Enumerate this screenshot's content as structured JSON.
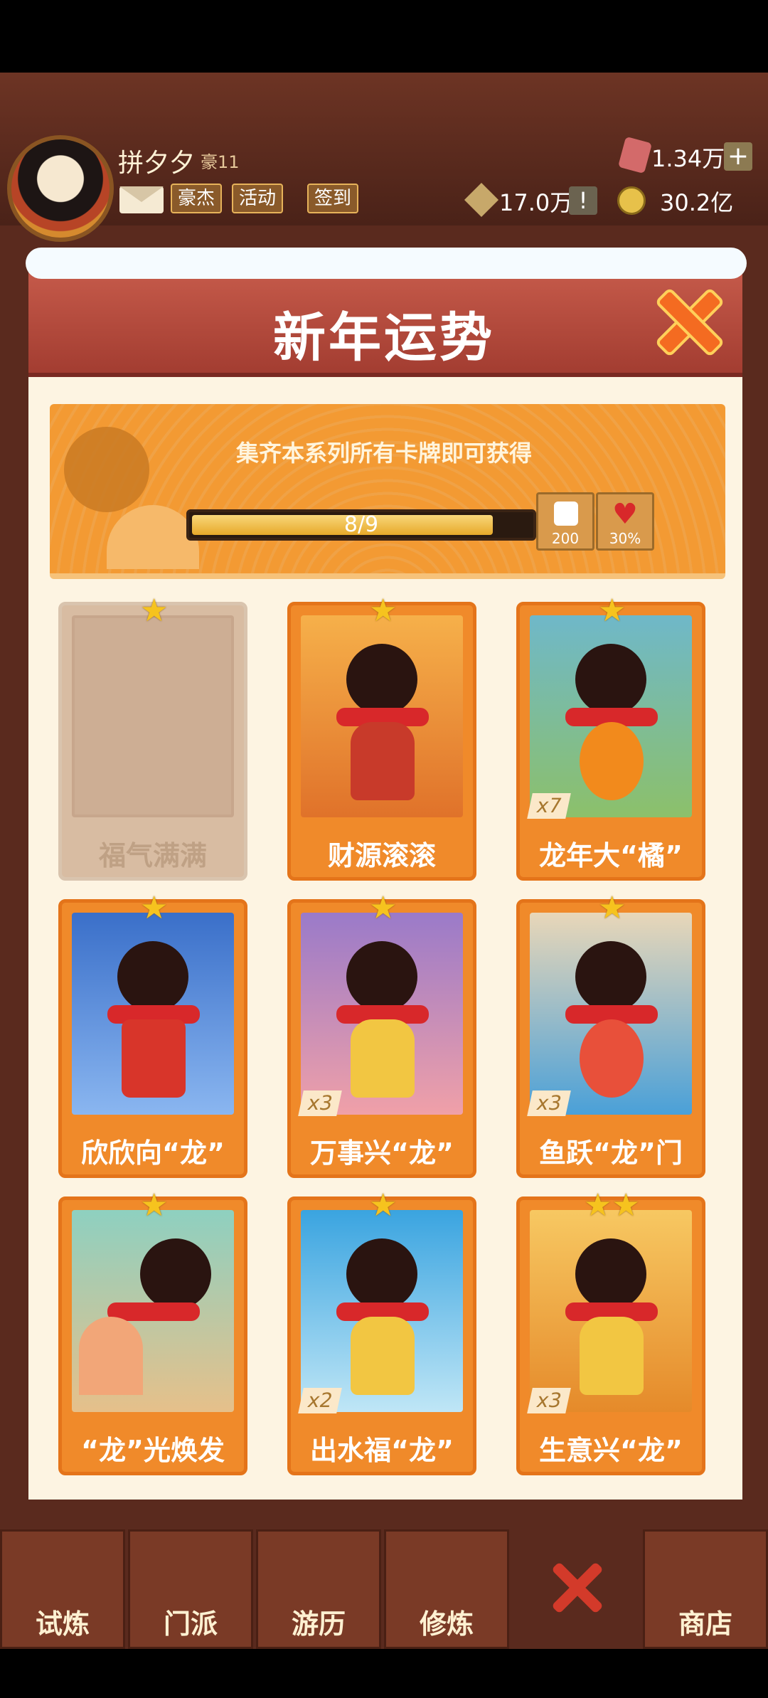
{
  "hud": {
    "player_name": "拼夕夕",
    "player_tier": "豪11",
    "buttons": [
      "豪杰",
      "活动",
      "签到"
    ],
    "gems": "1.34万",
    "tokens": "17.0万",
    "coins": "30.2亿"
  },
  "modal": {
    "title": "新年运势",
    "banner_text": "集齐本系列所有卡牌即可获得",
    "progress_text": "8/9",
    "progress_fraction": 0.889,
    "rewards": [
      {
        "icon": "dice-icon",
        "value": "200"
      },
      {
        "icon": "heart-icon",
        "value": "30%"
      }
    ]
  },
  "cards": [
    {
      "label": "福气满满",
      "stars": "★",
      "count": "",
      "collected": false
    },
    {
      "label": "财源滚滚",
      "stars": "★",
      "count": "",
      "collected": true
    },
    {
      "label": "龙年大“橘”",
      "stars": "★",
      "count": "x7",
      "collected": true
    },
    {
      "label": "欣欣向“龙”",
      "stars": "★",
      "count": "",
      "collected": true
    },
    {
      "label": "万事兴“龙”",
      "stars": "★",
      "count": "x3",
      "collected": true
    },
    {
      "label": "鱼跃“龙”门",
      "stars": "★",
      "count": "x3",
      "collected": true
    },
    {
      "label": "“龙”光焕发",
      "stars": "★",
      "count": "",
      "collected": true
    },
    {
      "label": "出水福“龙”",
      "stars": "★",
      "count": "x2",
      "collected": true
    },
    {
      "label": "生意兴“龙”",
      "stars": "★★",
      "count": "x3",
      "collected": true
    }
  ],
  "nav": [
    "试炼",
    "门派",
    "游历",
    "修炼",
    "商店"
  ],
  "colors": {
    "accent": "#f08a2a",
    "header": "#b2463a",
    "close": "#f46b21"
  }
}
